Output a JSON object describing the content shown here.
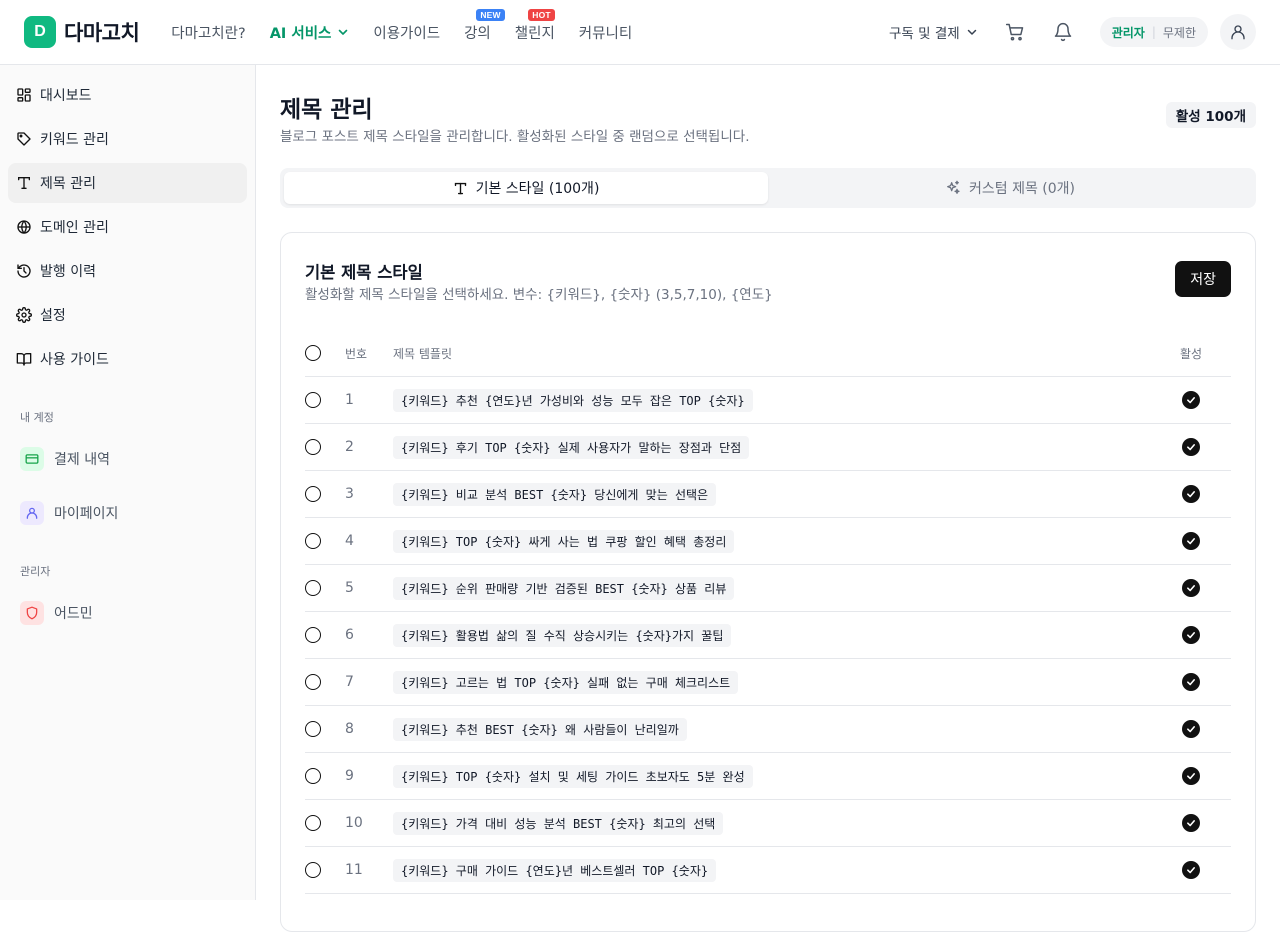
{
  "header": {
    "logo_letter": "D",
    "logo_text": "다마고치",
    "nav": [
      {
        "label": "다마고치란?",
        "active": false
      },
      {
        "label": "AI 서비스",
        "active": true
      },
      {
        "label": "이용가이드",
        "active": false
      },
      {
        "label": "강의",
        "active": false,
        "badge": "NEW"
      },
      {
        "label": "챌린지",
        "active": false,
        "badge": "HOT"
      },
      {
        "label": "커뮤니티",
        "active": false
      }
    ],
    "subscription_label": "구독 및 결제",
    "role_label": "관리자",
    "plan_label": "무제한"
  },
  "sidebar": {
    "items": [
      {
        "label": "대시보드"
      },
      {
        "label": "키워드 관리"
      },
      {
        "label": "제목 관리"
      },
      {
        "label": "도메인 관리"
      },
      {
        "label": "발행 이력"
      },
      {
        "label": "설정"
      },
      {
        "label": "사용 가이드"
      }
    ],
    "account_section": "내 계정",
    "account_items": [
      {
        "label": "결제 내역"
      },
      {
        "label": "마이페이지"
      }
    ],
    "admin_section": "관리자",
    "admin_items": [
      {
        "label": "어드민"
      }
    ]
  },
  "main": {
    "title": "제목 관리",
    "description": "블로그 포스트 제목 스타일을 관리합니다. 활성화된 스타일 중 랜덤으로 선택됩니다.",
    "active_count": "활성 100개",
    "tabs": [
      {
        "label": "기본 스타일 (100개)",
        "active": true
      },
      {
        "label": "커스텀 제목 (0개)",
        "active": false
      }
    ],
    "card": {
      "title": "기본 제목 스타일",
      "description": "활성화할 제목 스타일을 선택하세요. 변수: {키워드}, {숫자} (3,5,7,10), {연도}",
      "save_label": "저장",
      "columns": {
        "number": "번호",
        "template": "제목 템플릿",
        "active": "활성"
      },
      "rows": [
        {
          "number": "1",
          "template": "{키워드} 추천 {연도}년 가성비와 성능 모두 잡은 TOP {숫자}",
          "active": true
        },
        {
          "number": "2",
          "template": "{키워드} 후기 TOP {숫자} 실제 사용자가 말하는 장점과 단점",
          "active": true
        },
        {
          "number": "3",
          "template": "{키워드} 비교 분석 BEST {숫자} 당신에게 맞는 선택은",
          "active": true
        },
        {
          "number": "4",
          "template": "{키워드} TOP {숫자} 싸게 사는 법 쿠팡 할인 혜택 총정리",
          "active": true
        },
        {
          "number": "5",
          "template": "{키워드} 순위 판매량 기반 검증된 BEST {숫자} 상품 리뷰",
          "active": true
        },
        {
          "number": "6",
          "template": "{키워드} 활용법 삶의 질 수직 상승시키는 {숫자}가지 꿀팁",
          "active": true
        },
        {
          "number": "7",
          "template": "{키워드} 고르는 법 TOP {숫자} 실패 없는 구매 체크리스트",
          "active": true
        },
        {
          "number": "8",
          "template": "{키워드} 추천 BEST {숫자} 왜 사람들이 난리일까",
          "active": true
        },
        {
          "number": "9",
          "template": "{키워드} TOP {숫자} 설치 및 세팅 가이드 초보자도 5분 완성",
          "active": true
        },
        {
          "number": "10",
          "template": "{키워드} 가격 대비 성능 분석 BEST {숫자} 최고의 선택",
          "active": true
        },
        {
          "number": "11",
          "template": "{키워드} 구매 가이드 {연도}년 베스트셀러 TOP {숫자}",
          "active": true
        }
      ]
    }
  },
  "colors": {
    "brand": "#10b981",
    "active_nav": "#059669",
    "badge_new": "#3b82f6",
    "badge_hot": "#ef4444"
  }
}
